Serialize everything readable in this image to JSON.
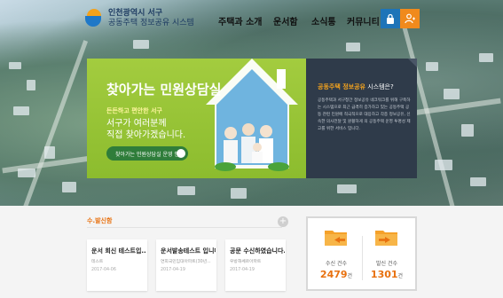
{
  "logo": {
    "line1": "인천광역시 서구",
    "line2": "공동주택 정보공유 시스템"
  },
  "nav": {
    "items": [
      "주택과 소개",
      "운서함",
      "소식통",
      "커뮤니티"
    ]
  },
  "banner": {
    "title": "찾아가는 민원상담실",
    "kicker": "든든하고 편안한 서구",
    "line1": "서구가 여러분께",
    "line2": "직접 찾아가겠습니다.",
    "button": "찾아가는 민원상담실 운영 안내"
  },
  "info": {
    "title_highlight": "공동주택 정보공유",
    "title_rest": " 시스템은?",
    "body": "공동주택과 서구청간 정보공유 네크워크를 위해 구축하는 시스템으로 최근 급격히 증가하고 있는 공동주택 공동 관련 민원에 적극적으로 대응하고 각종 정보공유, 신속한 의사전달 및 원활하게 의 공동주택 운영 투명성 제고를 위한 서비스 입니다."
  },
  "notice": {
    "heading": "수.발신함",
    "plus": "+",
    "cards": [
      {
        "title": "운서 회신 테스트입...",
        "sub": "테스트",
        "date": "2017-04-06"
      },
      {
        "title": "운서발송테스트 입니다",
        "sub": "연희국민임대아파트(30년...",
        "date": "2017-04-19"
      },
      {
        "title": "공문 수신하였습니다.",
        "sub": "우방해쎄르아파트",
        "date": "2017-04-19"
      }
    ]
  },
  "stats": {
    "received_label": "수신 건수",
    "received_value": "2479",
    "sent_label": "발신 건수",
    "sent_value": "1301",
    "unit": "건"
  },
  "colors": {
    "accent_orange": "#e8710f",
    "banner_green": "#8cbc2e",
    "panel_navy": "#2f3b4a",
    "lock_blue": "#1e74b8"
  }
}
